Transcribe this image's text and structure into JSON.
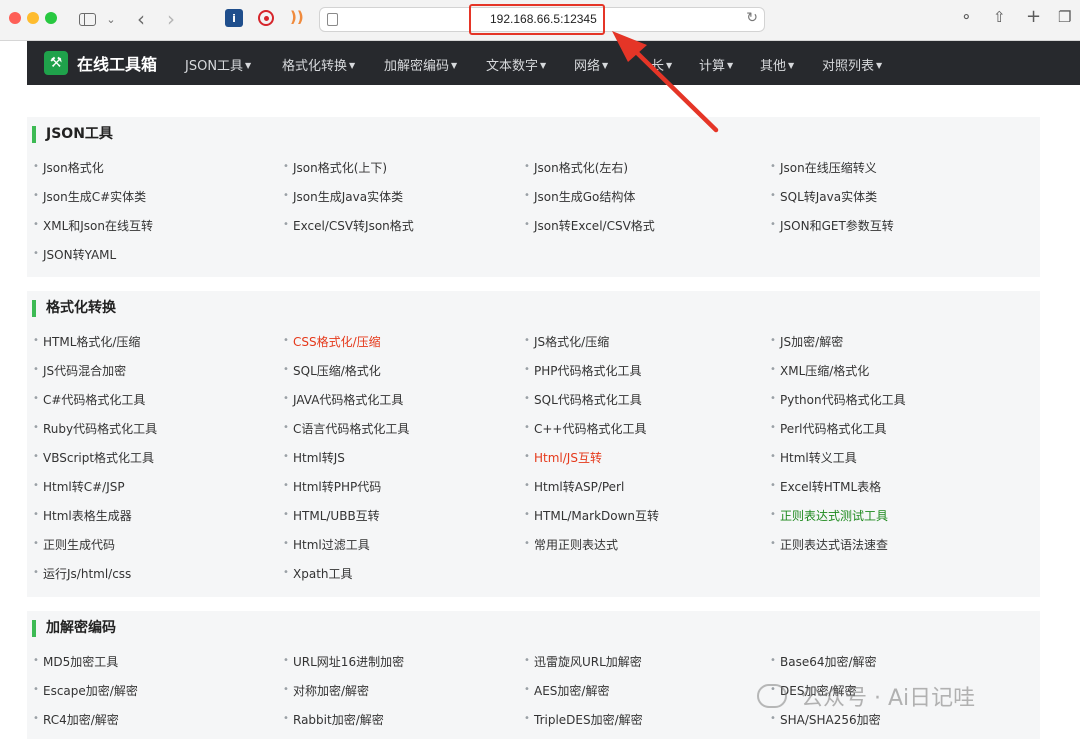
{
  "browser": {
    "url": "192.168.66.5:12345",
    "ext1_label": "i",
    "icons": [
      "sidebar-icon",
      "chevron-down-icon",
      "back-icon",
      "forward-icon",
      "download-icon",
      "share-icon",
      "new-tab-icon",
      "tabs-overview-icon"
    ]
  },
  "brand": {
    "name": "在线工具箱",
    "icon": "wrench-icon",
    "color": "#1fa24b"
  },
  "nav": [
    {
      "label": "JSON工具"
    },
    {
      "label": "格式化转换"
    },
    {
      "label": "加解密编码"
    },
    {
      "label": "文本数字"
    },
    {
      "label": "网络"
    },
    {
      "label": "长"
    },
    {
      "label": "计算"
    },
    {
      "label": "其他"
    },
    {
      "label": "对照列表"
    }
  ],
  "sections": [
    {
      "title": "JSON工具",
      "rows": [
        [
          {
            "t": "Json格式化"
          },
          {
            "t": "Json格式化(上下)"
          },
          {
            "t": "Json格式化(左右)"
          },
          {
            "t": "Json在线压缩转义"
          }
        ],
        [
          {
            "t": "Json生成C#实体类"
          },
          {
            "t": "Json生成Java实体类"
          },
          {
            "t": "Json生成Go结构体"
          },
          {
            "t": "SQL转Java实体类"
          }
        ],
        [
          {
            "t": "XML和Json在线互转"
          },
          {
            "t": "Excel/CSV转Json格式"
          },
          {
            "t": "Json转Excel/CSV格式"
          },
          {
            "t": "JSON和GET参数互转"
          }
        ],
        [
          {
            "t": "JSON转YAML"
          }
        ]
      ]
    },
    {
      "title": "格式化转换",
      "rows": [
        [
          {
            "t": "HTML格式化/压缩"
          },
          {
            "t": "CSS格式化/压缩",
            "c": "red"
          },
          {
            "t": "JS格式化/压缩"
          },
          {
            "t": "JS加密/解密"
          }
        ],
        [
          {
            "t": "JS代码混合加密"
          },
          {
            "t": "SQL压缩/格式化"
          },
          {
            "t": "PHP代码格式化工具"
          },
          {
            "t": "XML压缩/格式化"
          }
        ],
        [
          {
            "t": "C#代码格式化工具"
          },
          {
            "t": "JAVA代码格式化工具"
          },
          {
            "t": "SQL代码格式化工具"
          },
          {
            "t": "Python代码格式化工具"
          }
        ],
        [
          {
            "t": "Ruby代码格式化工具"
          },
          {
            "t": "C语言代码格式化工具"
          },
          {
            "t": "C++代码格式化工具"
          },
          {
            "t": "Perl代码格式化工具"
          }
        ],
        [
          {
            "t": "VBScript格式化工具"
          },
          {
            "t": "Html转JS"
          },
          {
            "t": "Html/JS互转",
            "c": "red"
          },
          {
            "t": "Html转义工具"
          }
        ],
        [
          {
            "t": "Html转C#/JSP"
          },
          {
            "t": "Html转PHP代码"
          },
          {
            "t": "Html转ASP/Perl"
          },
          {
            "t": "Excel转HTML表格"
          }
        ],
        [
          {
            "t": "Html表格生成器"
          },
          {
            "t": "HTML/UBB互转"
          },
          {
            "t": "HTML/MarkDown互转"
          },
          {
            "t": "正则表达式测试工具",
            "c": "green"
          }
        ],
        [
          {
            "t": "正则生成代码"
          },
          {
            "t": "Html过滤工具"
          },
          {
            "t": "常用正则表达式"
          },
          {
            "t": "正则表达式语法速查"
          }
        ],
        [
          {
            "t": "运行Js/html/css"
          },
          {
            "t": "Xpath工具"
          }
        ]
      ]
    },
    {
      "title": "加解密编码",
      "rows": [
        [
          {
            "t": "MD5加密工具"
          },
          {
            "t": "URL网址16进制加密"
          },
          {
            "t": "迅雷旋风URL加解密"
          },
          {
            "t": "Base64加密/解密"
          }
        ],
        [
          {
            "t": "Escape加密/解密"
          },
          {
            "t": "对称加密/解密"
          },
          {
            "t": "AES加密/解密"
          },
          {
            "t": "DES加密/解密"
          }
        ],
        [
          {
            "t": "RC4加密/解密"
          },
          {
            "t": "Rabbit加密/解密"
          },
          {
            "t": "TripleDES加密/解密"
          },
          {
            "t": "SHA/SHA256加密"
          }
        ]
      ]
    }
  ],
  "watermark": "公众号 · Ai日记哇",
  "colors": {
    "nav_bg": "#27292d",
    "accent_green": "#3dba54",
    "highlight_red": "#e5391b",
    "annotation_red": "#e53527"
  }
}
